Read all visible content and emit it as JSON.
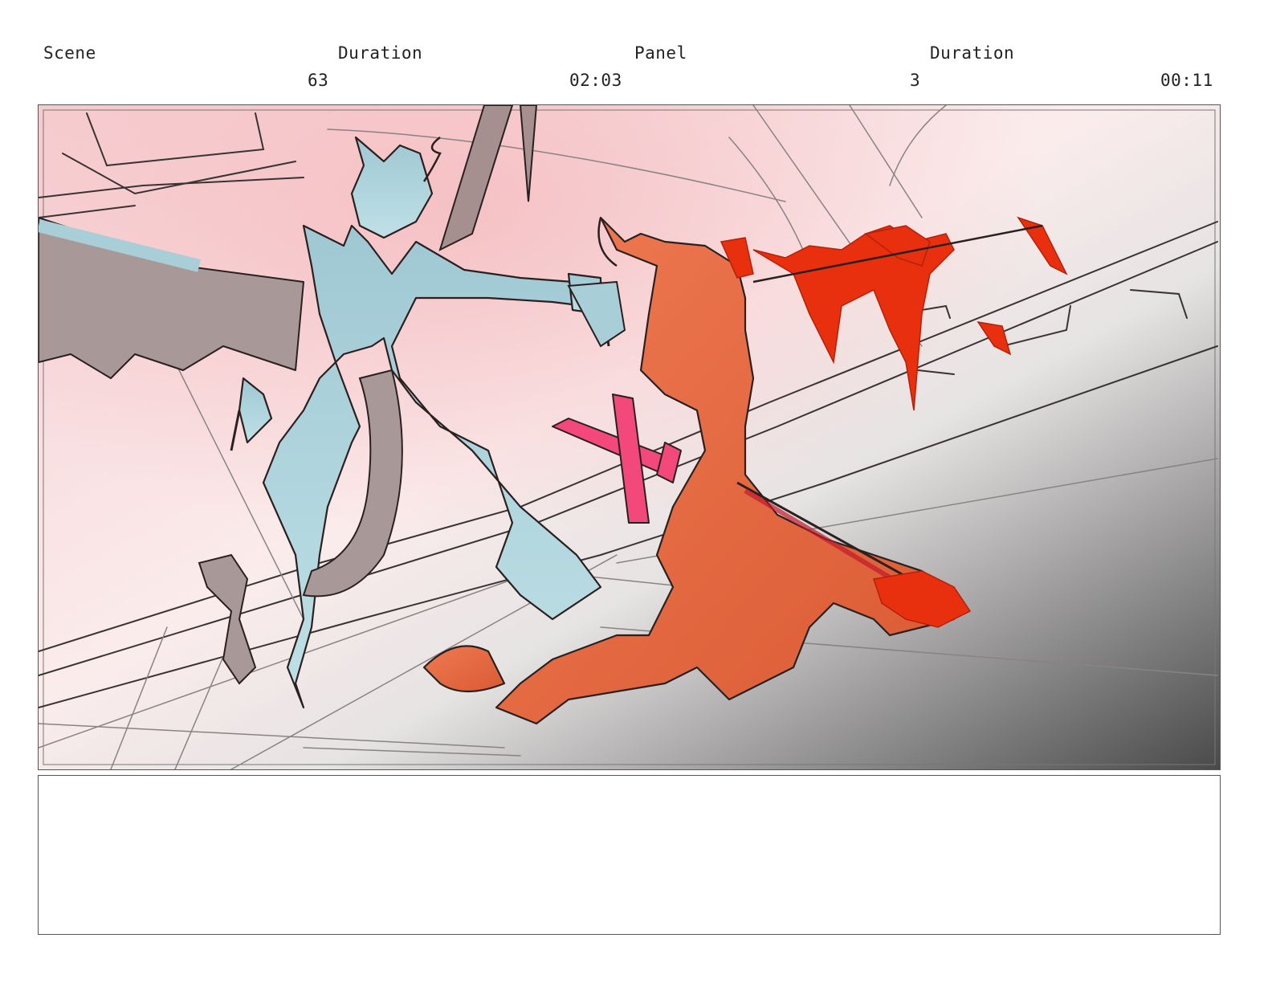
{
  "header": {
    "scene_label": "Scene",
    "scene_duration_label": "Duration",
    "panel_label": "Panel",
    "panel_duration_label": "Duration",
    "scene_number": "63",
    "scene_duration": "02:03",
    "panel_number": "3",
    "panel_duration": "00:11"
  },
  "colors": {
    "background_pink": "#f6cfd2",
    "background_grey": "#4a4a4a",
    "left_figure": "#a8cfd8",
    "right_figure": "#e8734a",
    "blood": "#e8300e",
    "sword": "#f2487a",
    "linework": "#2a2020"
  },
  "notes": {
    "text": ""
  }
}
